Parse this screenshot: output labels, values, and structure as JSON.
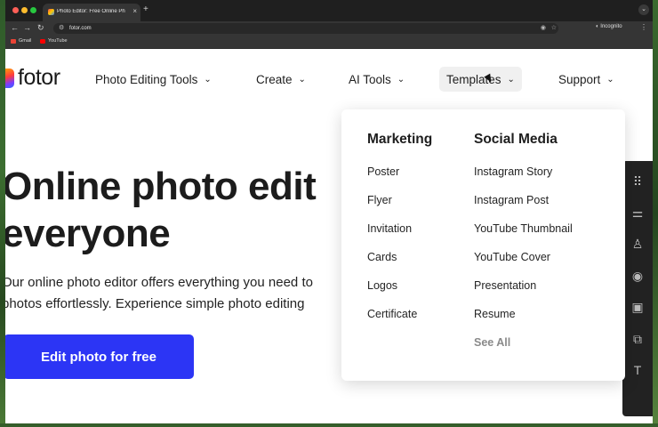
{
  "browser": {
    "tab_title": "Photo Editor: Free Online Ph",
    "tab_close": "×",
    "new_tab": "+",
    "url": "fotor.com",
    "incognito_label": "Incognito",
    "bookmarks": [
      "Gmail",
      "YouTube"
    ]
  },
  "site": {
    "logo_text": "fotor",
    "nav": [
      {
        "label": "Photo Editing Tools"
      },
      {
        "label": "Create"
      },
      {
        "label": "AI Tools"
      },
      {
        "label": "Templates"
      },
      {
        "label": "Support"
      }
    ],
    "chevron": "⌄"
  },
  "hero": {
    "title_line1": "Online photo edit",
    "title_line2": "everyone",
    "desc_line1": "Our online photo editor offers everything you need to",
    "desc_line2": "photos effortlessly. Experience simple photo editing",
    "cta": "Edit photo for free"
  },
  "dropdown": {
    "marketing": {
      "heading": "Marketing",
      "items": [
        "Poster",
        "Flyer",
        "Invitation",
        "Cards",
        "Logos",
        "Certificate"
      ]
    },
    "social": {
      "heading": "Social Media",
      "items": [
        "Instagram Story",
        "Instagram Post",
        "YouTube Thumbnail",
        "YouTube Cover",
        "Presentation",
        "Resume"
      ],
      "see_all": "See All"
    }
  },
  "side_panel_icons": [
    "grid-icon",
    "sliders-icon",
    "flask-icon",
    "eye-icon",
    "frame-icon",
    "shapes-icon",
    "text-icon"
  ],
  "colors": {
    "cta": "#2c35f5",
    "browser_dark": "#353535"
  }
}
